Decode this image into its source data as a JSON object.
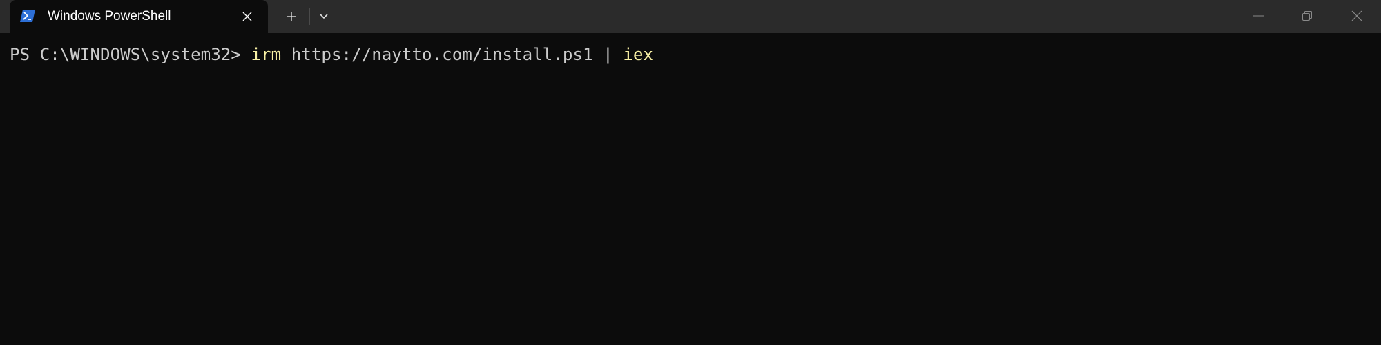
{
  "window": {
    "tab_title": "Windows PowerShell",
    "tab_icon": "powershell-icon",
    "new_tab_icon": "plus-icon",
    "dropdown_icon": "chevron-down-icon",
    "controls": [
      "minimize-icon",
      "restore-icon",
      "close-icon"
    ]
  },
  "colors": {
    "titlebar_bg": "#2b2b2b",
    "terminal_bg": "#0c0c0c",
    "text": "#cccccc",
    "command": "#f9f1a5",
    "icon_blue": "#2d6fd6"
  },
  "terminal": {
    "prompt": "PS C:\\WINDOWS\\system32> ",
    "cmd1": "irm",
    "arg1": " https://naytto.com/install.ps1 | ",
    "cmd2": "iex"
  }
}
